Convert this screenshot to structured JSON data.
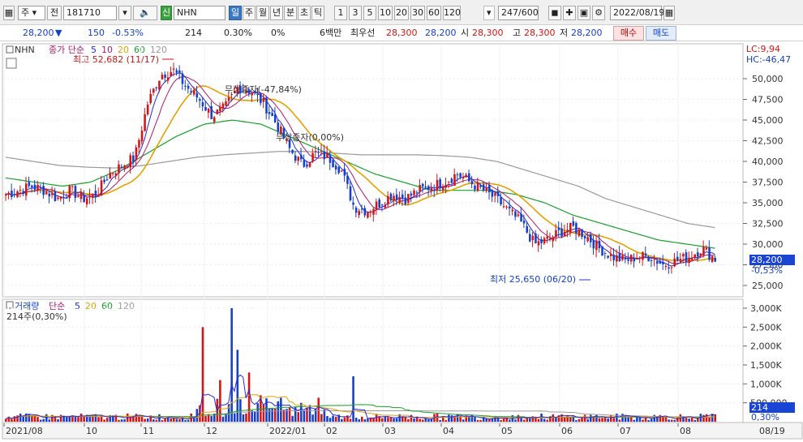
{
  "toolbar": {
    "market_select": "주",
    "period_button": "전",
    "code": "181710",
    "badge": "신",
    "name": "NHN",
    "periods": [
      "일",
      "주",
      "월",
      "년",
      "분",
      "초",
      "틱"
    ],
    "active_period": "일",
    "intervals": [
      "1",
      "3",
      "5",
      "10",
      "20",
      "30",
      "60",
      "120"
    ],
    "count": "247/600",
    "date": "2022/08/19"
  },
  "quote": {
    "price": "28,200",
    "arrow": "▼",
    "change": "150",
    "change_pct": "-0.53%",
    "volume": "214",
    "volume_pct": "0.30%",
    "pct2": "0%",
    "unit_label": "6백만",
    "best_ask_label": "최우선",
    "best_ask": "28,300",
    "best_bid": "28,200",
    "open_label": "시",
    "open": "28,300",
    "high_label": "고",
    "high": "28,300",
    "low_label": "저",
    "low": "28,200",
    "buy_label": "매수",
    "sell_label": "매도"
  },
  "price_panel": {
    "legend_name": "NHN",
    "legend_type": "종가 단순",
    "ma_periods": [
      "5",
      "10",
      "20",
      "60",
      "120"
    ],
    "ma_colors": [
      "#2a2ad8",
      "#b01a6a",
      "#e3a200",
      "#18a02c",
      "#9a9a9a"
    ],
    "high_annotation": "최고 52,682 (11/17)",
    "drop_annotation": "무상증자(-47,84%)",
    "bonus_annotation": "무상증자(0,00%)",
    "low_annotation": "최저 25,650 (06/20)",
    "lc_label": "LC:9,94",
    "hc_label": "HC:-46,47",
    "current_price": "28,200",
    "current_pct": "-0,53%",
    "y_ticks": [
      "50,000",
      "47,500",
      "45,000",
      "42,500",
      "40,000",
      "37,500",
      "35,000",
      "32,500",
      "30,000",
      "27,500",
      "25,000"
    ]
  },
  "volume_panel": {
    "legend_name": "거래량",
    "legend_type": "단순",
    "ma_periods": [
      "5",
      "20",
      "60",
      "120"
    ],
    "ma_colors": [
      "#2a2ad8",
      "#e3a200",
      "#18a02c",
      "#9a9a9a"
    ],
    "sub_label": "214주(0,30%)",
    "current_volume": "214",
    "current_pct": "0,30%",
    "y_ticks": [
      "3,000K",
      "2,500K",
      "2,000K",
      "1,500K",
      "1,000K",
      "500,000"
    ]
  },
  "x_axis": {
    "labels": [
      "2021/08",
      "10",
      "11",
      "12",
      "2022/01",
      "02",
      "03",
      "04",
      "05",
      "06",
      "07",
      "08"
    ],
    "right_label": "08/19"
  },
  "colors": {
    "up": "#d21616",
    "down": "#1740c8",
    "ma5": "#2a2ad8",
    "ma10": "#b01a6a",
    "ma20": "#e3a200",
    "ma60": "#18a02c",
    "ma120": "#9a9a9a"
  },
  "chart_data": {
    "type": "candlestick",
    "price_series_approx": [
      36000,
      36500,
      37000,
      36500,
      35500,
      36500,
      35500,
      36000,
      38500,
      39500,
      40500,
      47000,
      50500,
      51000,
      49000,
      47500,
      45500,
      46500,
      49000,
      48500,
      47000,
      44500,
      41500,
      39500,
      41000,
      40500,
      39000,
      34500,
      34000,
      35000,
      36000,
      35500,
      36500,
      37000,
      37500,
      38500,
      37500,
      36500,
      35500,
      34000,
      32500,
      30000,
      30500,
      31500,
      32000,
      31000,
      29500,
      28500,
      28000,
      28500,
      28500,
      27500,
      28000,
      28500,
      29500,
      28200
    ],
    "ma120_series_approx": [
      40500,
      40000,
      39500,
      39300,
      39200,
      39500,
      40000,
      40500,
      40800,
      41000,
      41200,
      41200,
      41000,
      40800,
      40800,
      40800,
      40700,
      40500,
      40000,
      39000,
      38000,
      37000,
      35500,
      34500,
      33500,
      32500,
      32000
    ],
    "ma60_series_approx": [
      38000,
      37500,
      37000,
      37500,
      39000,
      41000,
      43000,
      44500,
      45000,
      44500,
      43000,
      41500,
      40000,
      38500,
      37500,
      36500,
      36500,
      36500,
      36000,
      35000,
      33500,
      32500,
      31500,
      30500,
      30000,
      29500
    ],
    "volume_peaks_k": [
      {
        "label": "11",
        "value": 2500
      },
      {
        "label": "11",
        "value": 3000
      },
      {
        "label": "12",
        "value": 1300
      },
      {
        "label": "12",
        "value": 1200
      }
    ],
    "ylim_price": [
      25000,
      52682
    ],
    "ylim_volume": [
      0,
      3000
    ]
  }
}
